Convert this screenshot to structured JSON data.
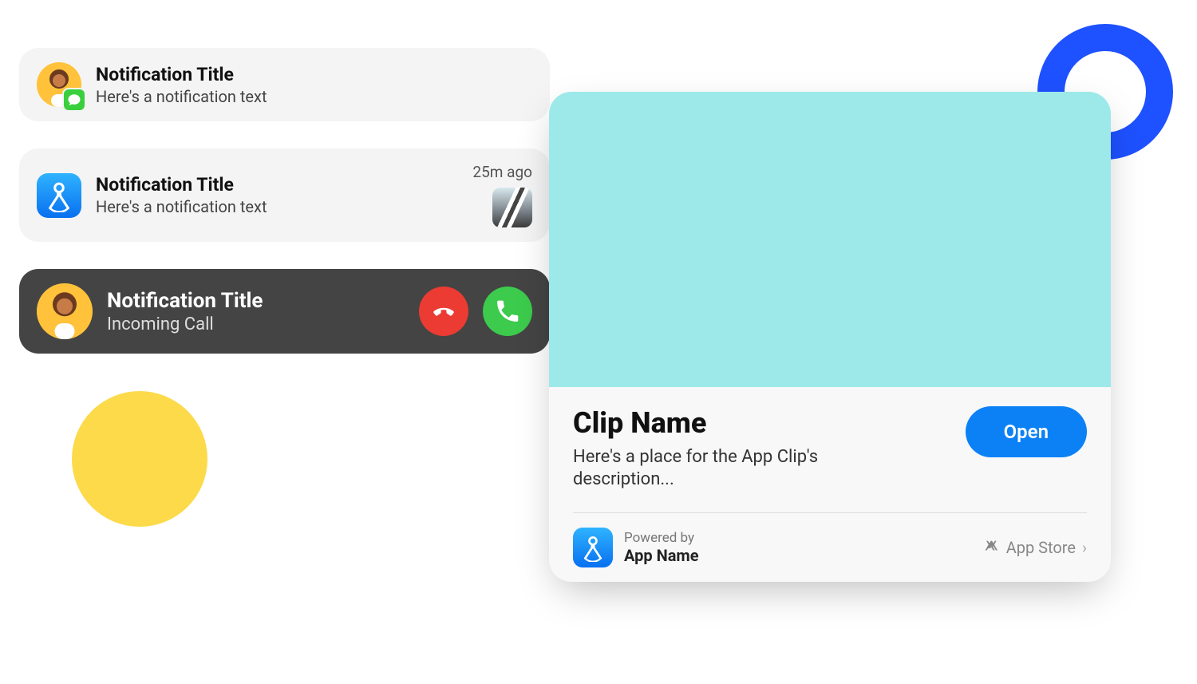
{
  "decor": {
    "ring_color": "#1E51FF",
    "dot_color": "#FCDA4A"
  },
  "notifications": [
    {
      "title": "Notification Title",
      "body": "Here's a notification text",
      "avatar": "person",
      "badge_icon": "message-bubble-icon"
    },
    {
      "title": "Notification Title",
      "body": "Here's a notification text",
      "app_icon": "compass-app-icon",
      "time": "25m ago",
      "thumbnail": "roof-thumbnail"
    },
    {
      "title": "Notification Title",
      "body": "Incoming Call",
      "avatar": "person",
      "variant": "dark",
      "actions": {
        "decline": "decline-call",
        "accept": "accept-call"
      }
    }
  ],
  "clip": {
    "name": "Clip Name",
    "description": "Here's a place for the App Clip's description...",
    "open_label": "Open",
    "powered_by_label": "Powered by",
    "app_name": "App Name",
    "store_label": "App Store",
    "hero_color": "#9DE9E9"
  }
}
